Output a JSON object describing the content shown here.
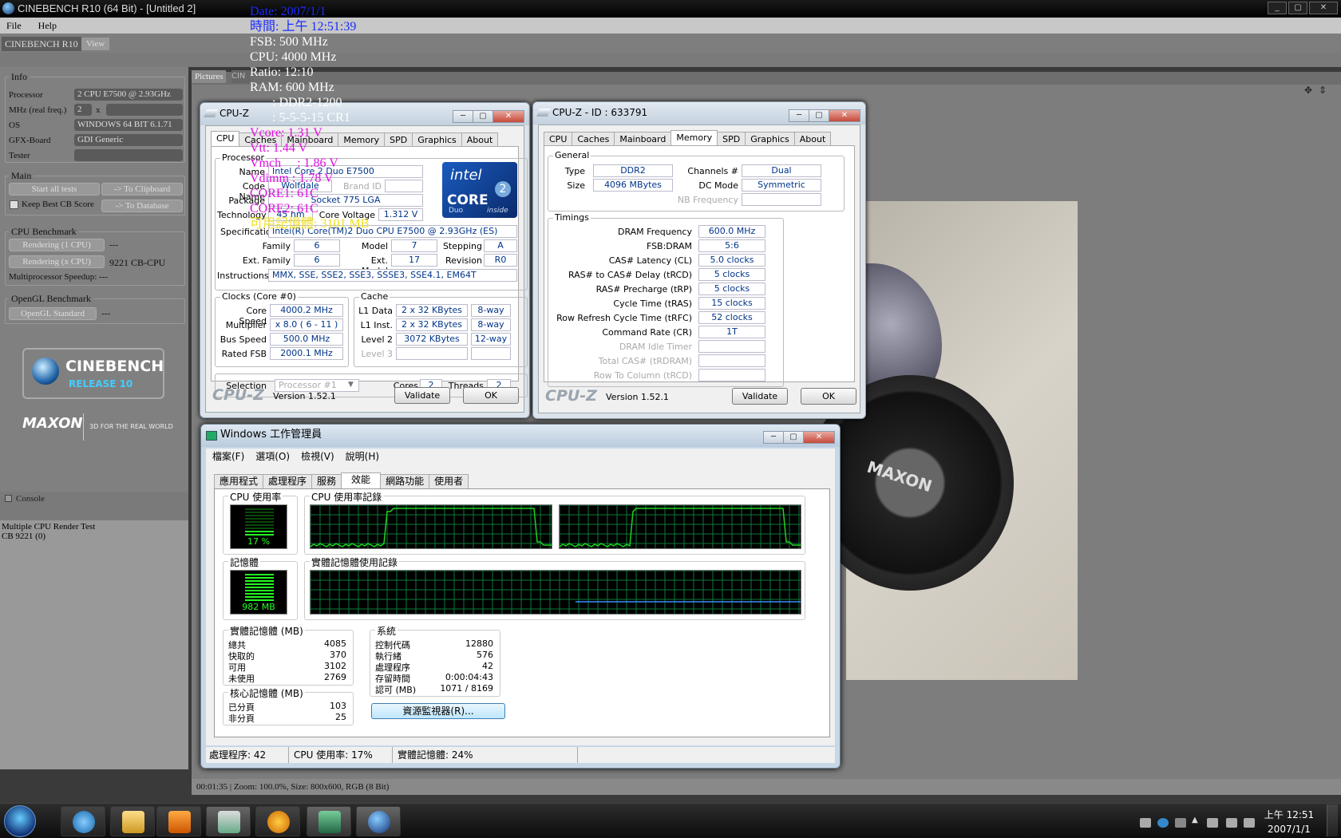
{
  "cinebench": {
    "window_title": "CINEBENCH R10 (64 Bit) - [Untitled 2]",
    "menu": [
      "File",
      "Help"
    ],
    "tab_main": "CINEBENCH R10",
    "tab_view": "View",
    "info_title": "Info",
    "info": {
      "processor_label": "Processor",
      "processor_value": "2 CPU E7500 @ 2.93GHz",
      "mhz_label": "MHz (real freq.)",
      "mhz_value": "2",
      "mhz_x": "x",
      "os_label": "OS",
      "os_value": "WINDOWS 64 BIT 6.1.71",
      "gfx_label": "GFX-Board",
      "gfx_value": "GDI Generic",
      "tester_label": "Tester",
      "tester_value": ""
    },
    "main_title": "Main",
    "start_all": "Start all tests",
    "to_clipboard": "-> To Clipboard",
    "keep_best": "Keep Best CB Score",
    "to_database": "-> To Database",
    "cpu_bench_title": "CPU Benchmark",
    "render_1cpu": "Rendering (1 CPU)",
    "render_1cpu_val": "---",
    "render_xcpu": "Rendering (x CPU)",
    "render_xcpu_val": "9221 CB-CPU",
    "mp_speedup": "Multiprocessor Speedup: ---",
    "opengl_title": "OpenGL Benchmark",
    "opengl_std": "OpenGL Standard",
    "opengl_val": "---",
    "logo_name": "CINEBENCH",
    "logo_release": "RELEASE 10",
    "maxon": "MAXON",
    "maxon_tag": "3D FOR THE REAL WORLD",
    "console_label": "Console",
    "console_lines": [
      "Multiple CPU Render Test",
      "CB 9221 (0)"
    ],
    "pictures_tab": "Pictures",
    "pictures_tab2": "CIN",
    "status": "00:01:35 | Zoom: 100.0%, Size: 800x600, RGB (8 Bit)",
    "scene_brand": "MAXON"
  },
  "overlay": {
    "date": "Date: 2007/1/1",
    "time": "時間: 上午 12:51:39",
    "fsb": "FSB: 500 MHz",
    "cpu": "CPU: 4000 MHz",
    "ratio": "Ratio: 12:10",
    "ram": "RAM: 600 MHz",
    "ddr": "       : DDR2-1200",
    "timing": "       : 5-5-5-15 CR1",
    "vcore": "Vcore: 1.31 V",
    "vtt": "Vtt: 1.44 V",
    "vmch": "Vmch     : 1.86 V",
    "vdimm": "Vdimm : 1.78 V",
    "core1": "CORE1: 61C",
    "core2": "CORE2: 61C",
    "avail_mem": "可用記憶體: 3101 MB",
    "colors": {
      "blue": "#1a2bff",
      "magenta": "#e010e0",
      "yellow": "#f0e020"
    }
  },
  "cpuz1": {
    "title": "CPU-Z",
    "tabs": [
      "CPU",
      "Caches",
      "Mainboard",
      "Memory",
      "SPD",
      "Graphics",
      "About"
    ],
    "processor_grp": "Processor",
    "name_label": "Name",
    "name_value": "Intel Core 2 Duo E7500",
    "codename_label": "Code Name",
    "codename_value": "Wolfdale",
    "brandid_label": "Brand ID",
    "package_label": "Package",
    "package_value": "Socket 775 LGA",
    "tech_label": "Technology",
    "tech_value": "45 nm",
    "corev_label": "Core Voltage",
    "corev_value": "1.312 V",
    "spec_label": "Specification",
    "spec_value": "Intel(R) Core(TM)2 Duo CPU E7500 @ 2.93GHz (ES)",
    "family_label": "Family",
    "family_value": "6",
    "model_label": "Model",
    "model_value": "7",
    "stepping_label": "Stepping",
    "stepping_value": "A",
    "extfam_label": "Ext. Family",
    "extfam_value": "6",
    "extmodel_label": "Ext. Model",
    "extmodel_value": "17",
    "revision_label": "Revision",
    "revision_value": "R0",
    "instr_label": "Instructions",
    "instr_value": "MMX, SSE, SSE2, SSE3, SSSE3, SSE4.1, EM64T",
    "clocks_grp": "Clocks (Core #0)",
    "corespeed_label": "Core Speed",
    "corespeed_value": "4000.2 MHz",
    "mult_label": "Multiplier",
    "mult_value": "x 8.0 ( 6 - 11 )",
    "busspeed_label": "Bus Speed",
    "busspeed_value": "500.0 MHz",
    "ratedfsb_label": "Rated FSB",
    "ratedfsb_value": "2000.1 MHz",
    "cache_grp": "Cache",
    "l1d_label": "L1 Data",
    "l1d_value": "2 x 32 KBytes",
    "l1d_way": "8-way",
    "l1i_label": "L1 Inst.",
    "l1i_value": "2 x 32 KBytes",
    "l1i_way": "8-way",
    "l2_label": "Level 2",
    "l2_value": "3072 KBytes",
    "l2_way": "12-way",
    "l3_label": "Level 3",
    "selection_label": "Selection",
    "selection_value": "Processor #1",
    "cores_label": "Cores",
    "cores_value": "2",
    "threads_label": "Threads",
    "threads_value": "2",
    "logo": "CPU-Z",
    "version": "Version 1.52.1",
    "validate": "Validate",
    "ok": "OK",
    "intel_badge": {
      "brand": "intel",
      "core": "CORE",
      "duo": "Duo",
      "inside": "inside"
    }
  },
  "cpuz2": {
    "title": "CPU-Z - ID : 633791",
    "tabs": [
      "CPU",
      "Caches",
      "Mainboard",
      "Memory",
      "SPD",
      "Graphics",
      "About"
    ],
    "general_grp": "General",
    "type_label": "Type",
    "type_value": "DDR2",
    "size_label": "Size",
    "size_value": "4096 MBytes",
    "channels_label": "Channels #",
    "channels_value": "Dual",
    "dcmode_label": "DC Mode",
    "dcmode_value": "Symmetric",
    "nbfreq_label": "NB Frequency",
    "timings_grp": "Timings",
    "timings": [
      {
        "label": "DRAM Frequency",
        "value": "600.0 MHz"
      },
      {
        "label": "FSB:DRAM",
        "value": "5:6"
      },
      {
        "label": "CAS# Latency (CL)",
        "value": "5.0 clocks"
      },
      {
        "label": "RAS# to CAS# Delay (tRCD)",
        "value": "5 clocks"
      },
      {
        "label": "RAS# Precharge (tRP)",
        "value": "5 clocks"
      },
      {
        "label": "Cycle Time (tRAS)",
        "value": "15 clocks"
      },
      {
        "label": "Row Refresh Cycle Time (tRFC)",
        "value": "52 clocks"
      },
      {
        "label": "Command Rate (CR)",
        "value": "1T"
      },
      {
        "label": "DRAM Idle Timer",
        "value": ""
      },
      {
        "label": "Total CAS# (tRDRAM)",
        "value": ""
      },
      {
        "label": "Row To Column (tRCD)",
        "value": ""
      }
    ],
    "logo": "CPU-Z",
    "version": "Version 1.52.1",
    "validate": "Validate",
    "ok": "OK"
  },
  "taskmgr": {
    "title": "Windows 工作管理員",
    "menu": [
      "檔案(F)",
      "選項(O)",
      "檢視(V)",
      "說明(H)"
    ],
    "tabs": [
      "應用程式",
      "處理程序",
      "服務",
      "效能",
      "網路功能",
      "使用者"
    ],
    "cpu_usage_title": "CPU 使用率",
    "cpu_usage_value": "17 %",
    "cpu_history_title": "CPU 使用率記錄",
    "mem_title": "記憶體",
    "mem_value": "982 MB",
    "mem_history_title": "實體記憶體使用記錄",
    "phys_title": "實體記憶體 (MB)",
    "phys": [
      {
        "label": "總共",
        "value": "4085"
      },
      {
        "label": "快取的",
        "value": "370"
      },
      {
        "label": "可用",
        "value": "3102"
      },
      {
        "label": "未使用",
        "value": "2769"
      }
    ],
    "kernel_title": "核心記憶體 (MB)",
    "kernel": [
      {
        "label": "已分頁",
        "value": "103"
      },
      {
        "label": "非分頁",
        "value": "25"
      }
    ],
    "system_title": "系統",
    "system": [
      {
        "label": "控制代碼",
        "value": "12880"
      },
      {
        "label": "執行緒",
        "value": "576"
      },
      {
        "label": "處理程序",
        "value": "42"
      },
      {
        "label": "存留時間",
        "value": "0:00:04:43"
      },
      {
        "label": "認可 (MB)",
        "value": "1071 / 8169"
      }
    ],
    "resmon_button": "資源監視器(R)...",
    "status_processes": "處理程序: 42",
    "status_cpu": "CPU 使用率: 17%",
    "status_mem": "實體記憶體: 24%",
    "graph_color": "#1fd31f",
    "grid_color": "#0a7a3a",
    "mem_line_color": "#3a8cff"
  },
  "taskbar": {
    "clock_time": "上午 12:51",
    "clock_date": "2007/1/1"
  }
}
